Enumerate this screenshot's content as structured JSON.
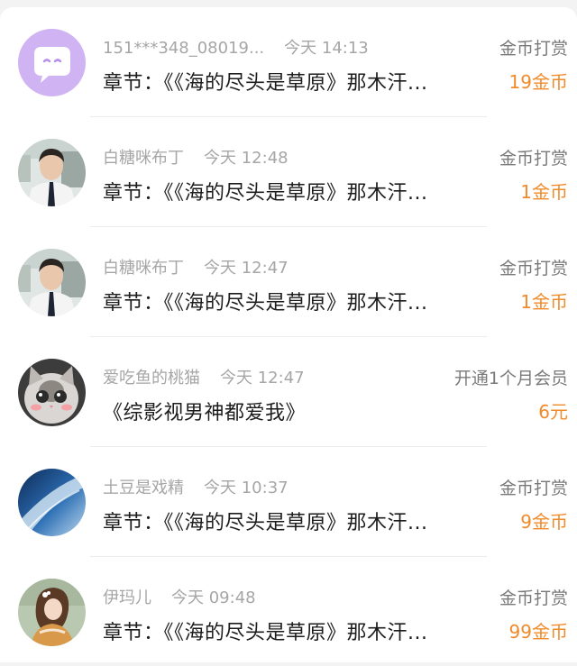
{
  "records": [
    {
      "avatar_icon": "message-bubble-avatar-icon",
      "username": "151***348_08019...",
      "time": "今天 14:13",
      "content": "章节：《《海的尽头是草原》那木汗...",
      "type": "金币打赏",
      "amount": "19金币"
    },
    {
      "avatar_icon": "boy-photo-avatar",
      "username": "白糖咪布丁",
      "time": "今天 12:48",
      "content": "章节：《《海的尽头是草原》那木汗...",
      "type": "金币打赏",
      "amount": "1金币"
    },
    {
      "avatar_icon": "boy-photo-avatar",
      "username": "白糖咪布丁",
      "time": "今天 12:47",
      "content": "章节：《《海的尽头是草原》那木汗...",
      "type": "金币打赏",
      "amount": "1金币"
    },
    {
      "avatar_icon": "cat-photo-avatar",
      "username": "爱吃鱼的桃猫",
      "time": "今天 12:47",
      "content": "《综影视男神都爱我》",
      "type": "开通1个月会员",
      "amount": "6元"
    },
    {
      "avatar_icon": "earth-photo-avatar",
      "username": "土豆是戏精",
      "time": "今天 10:37",
      "content": "章节：《《海的尽头是草原》那木汗...",
      "type": "金币打赏",
      "amount": "9金币"
    },
    {
      "avatar_icon": "girl-illustration-avatar",
      "username": "伊玛儿",
      "time": "今天 09:48",
      "content": "章节：《《海的尽头是草原》那木汗...",
      "type": "金币打赏",
      "amount": "99金币"
    }
  ],
  "colors": {
    "amount": "#f08a2a",
    "meta_text": "#a6a6a6",
    "title_text": "#1c1c1c",
    "background": "#f3f3f3"
  }
}
